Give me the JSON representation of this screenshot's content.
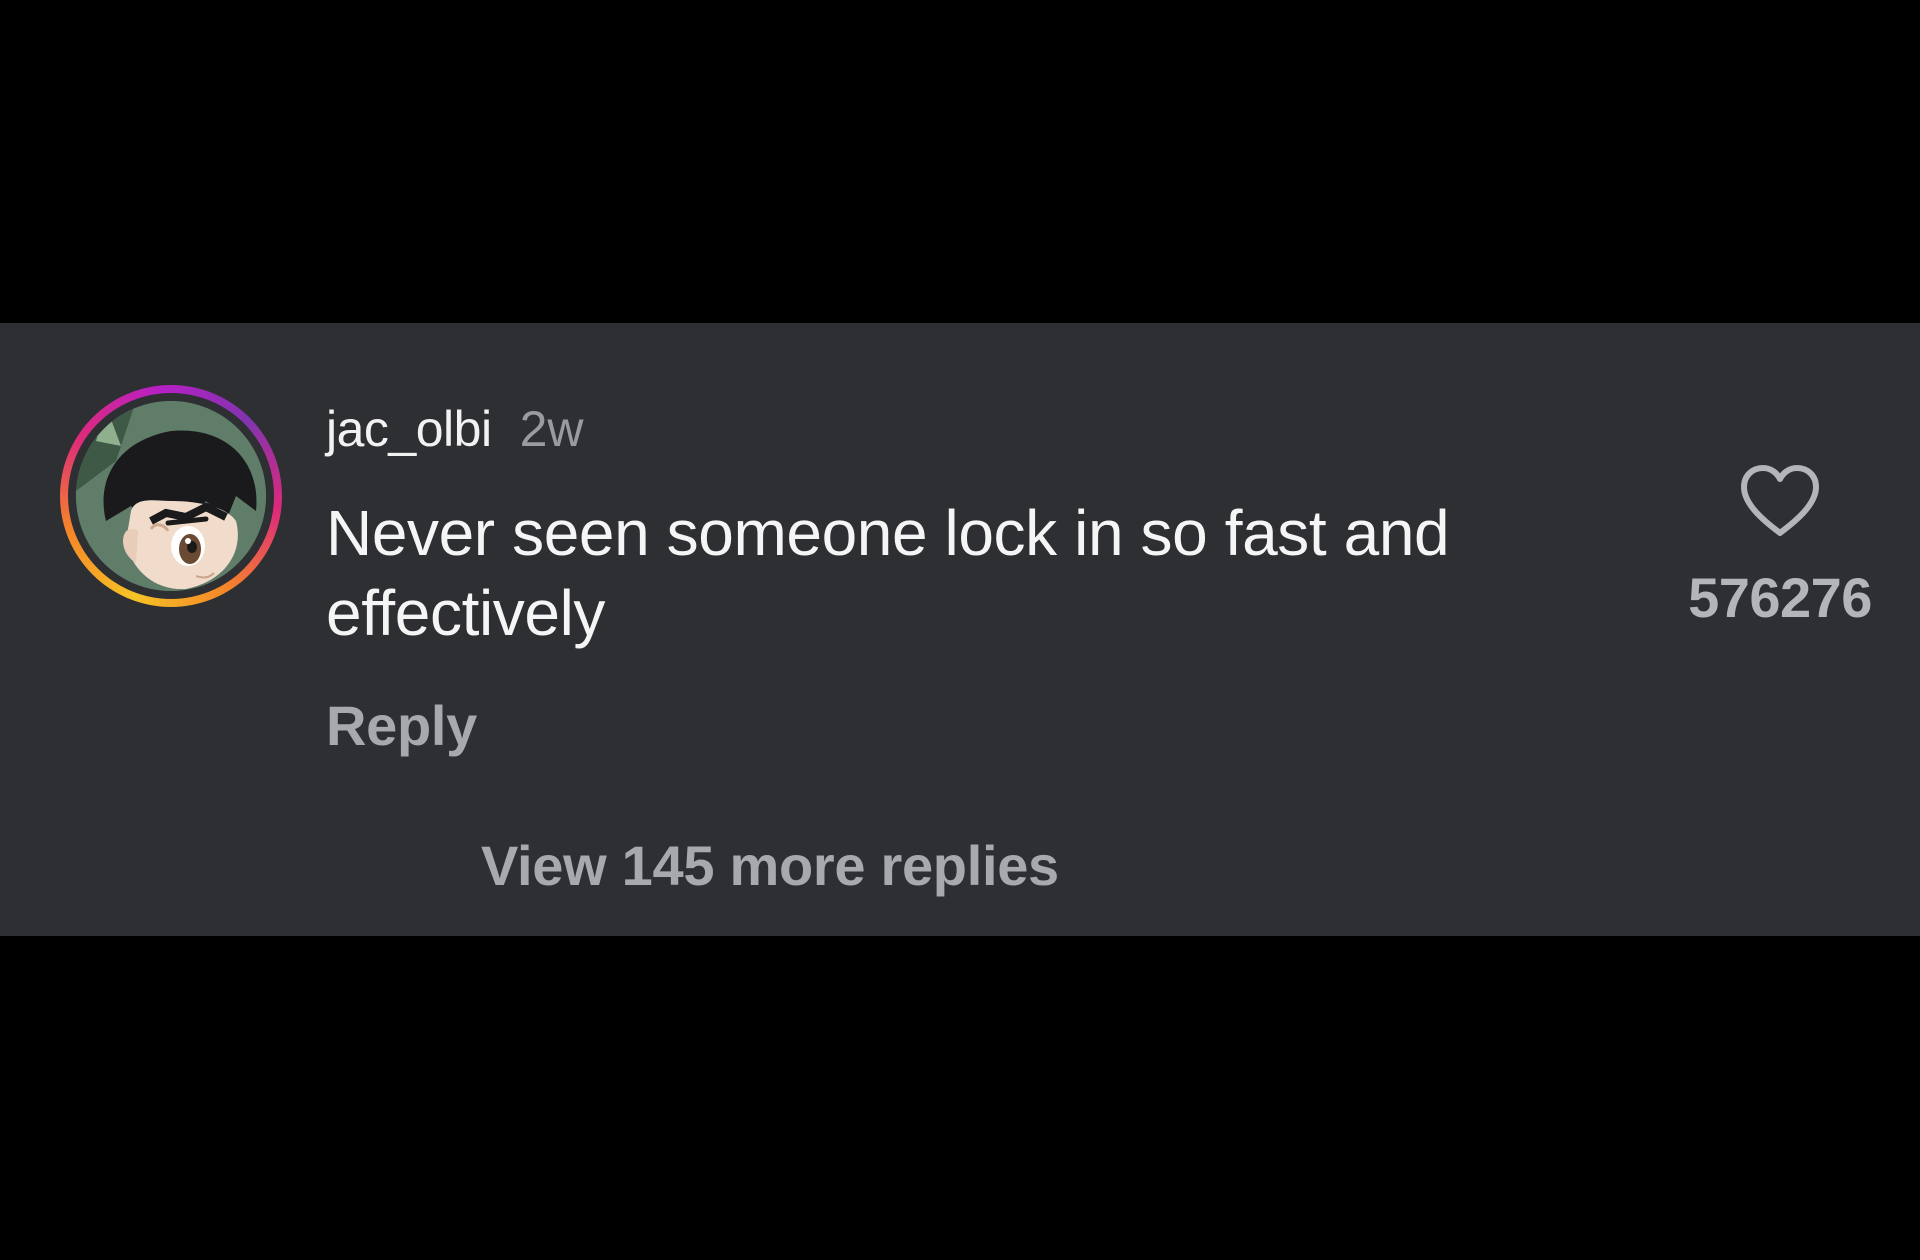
{
  "comment": {
    "username": "jac_olbi",
    "timestamp": "2w",
    "text": "Never seen someone lock in so fast and effectively",
    "reply_label": "Reply",
    "like_count": "576276",
    "like_icon": "heart-outline-icon",
    "avatar_ring_colors": [
      "#f7c325",
      "#f58529",
      "#dd2a7b",
      "#b620c6"
    ]
  },
  "replies": {
    "view_more_label": "View 145 more replies"
  },
  "colors": {
    "card_background": "#2e2f33",
    "page_background": "#000000",
    "primary_text": "#f5f5f5",
    "secondary_text": "#a8a9ae"
  }
}
